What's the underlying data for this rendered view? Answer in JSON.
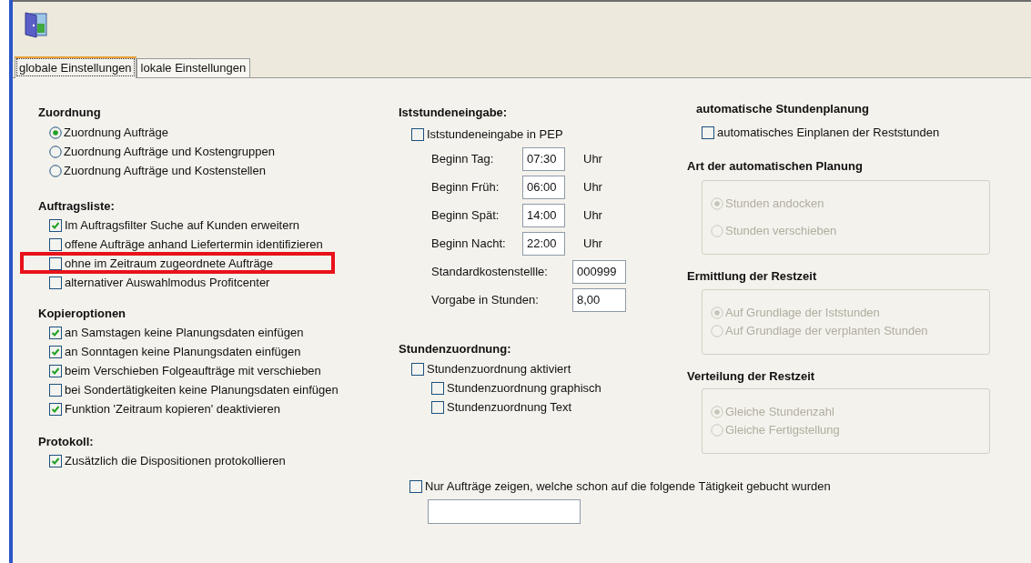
{
  "tabs": [
    {
      "label": "globale Einstellungen",
      "selected": true
    },
    {
      "label": "lokale Einstellungen",
      "selected": false
    }
  ],
  "zuordnung": {
    "title": "Zuordnung",
    "options": [
      {
        "label": "Zuordnung Aufträge",
        "selected": true
      },
      {
        "label": "Zuordnung Aufträge und Kostengruppen",
        "selected": false
      },
      {
        "label": "Zuordnung Aufträge und Kostenstellen",
        "selected": false
      }
    ]
  },
  "auftragsliste": {
    "title": "Auftragsliste:",
    "items": [
      {
        "label": "Im Auftragsfilter Suche auf Kunden erweitern",
        "checked": true,
        "highlighted": false
      },
      {
        "label": "offene Aufträge anhand Liefertermin identifizieren",
        "checked": false,
        "highlighted": false
      },
      {
        "label": "ohne im Zeitraum zugeordnete Aufträge",
        "checked": false,
        "highlighted": true
      },
      {
        "label": "alternativer Auswahlmodus Profitcenter",
        "checked": false,
        "highlighted": false
      }
    ]
  },
  "kopieroptionen": {
    "title": "Kopieroptionen",
    "items": [
      {
        "label": "an Samstagen keine Planungsdaten einfügen",
        "checked": true
      },
      {
        "label": "an Sonntagen keine Planungsdaten einfügen",
        "checked": true
      },
      {
        "label": "beim Verschieben Folgeaufträge mit verschieben",
        "checked": true
      },
      {
        "label": "bei Sondertätigkeiten keine Planungsdaten einfügen",
        "checked": false
      },
      {
        "label": "Funktion 'Zeitraum kopieren' deaktivieren",
        "checked": true
      }
    ]
  },
  "protokoll": {
    "title": "Protokoll:",
    "items": [
      {
        "label": "Zusätzlich die Dispositionen protokollieren",
        "checked": true
      }
    ]
  },
  "iststundeneingabe": {
    "title": "Iststundeneingabe:",
    "checkbox": {
      "label": "Iststundeneingabe in PEP",
      "checked": false
    },
    "fields": [
      {
        "kind": "time",
        "label": "Beginn Tag:",
        "value": "07:30",
        "unit": "Uhr"
      },
      {
        "kind": "time",
        "label": "Beginn Früh:",
        "value": "06:00",
        "unit": "Uhr"
      },
      {
        "kind": "time",
        "label": "Beginn Spät:",
        "value": "14:00",
        "unit": "Uhr"
      },
      {
        "kind": "time",
        "label": "Beginn Nacht:",
        "value": "22:00",
        "unit": "Uhr"
      },
      {
        "kind": "number",
        "label": "Standardkostenstellle:",
        "value": "000999"
      },
      {
        "kind": "number",
        "label": "Vorgabe in Stunden:",
        "value": "8,00"
      }
    ]
  },
  "stundenzuordnung": {
    "title": "Stundenzuordnung:",
    "checkbox": {
      "label": "Stundenzuordnung aktiviert",
      "checked": false,
      "children": [
        {
          "label": "Stundenzuordnung graphisch",
          "checked": false
        },
        {
          "label": "Stundenzuordnung Text",
          "checked": false
        }
      ]
    }
  },
  "automatische_stundenplanung": {
    "title": "automatische Stundenplanung",
    "checkbox": {
      "label": "automatisches Einplanen der Reststunden",
      "checked": false
    }
  },
  "planungsgruppen": [
    {
      "title": "Art der automatischen Planung",
      "disabled": true,
      "options": [
        {
          "label": "Stunden andocken",
          "selected": true
        },
        {
          "label": "Stunden verschieben",
          "selected": false
        }
      ]
    },
    {
      "title": "Ermittlung der Restzeit",
      "disabled": true,
      "options": [
        {
          "label": "Auf Grundlage der Iststunden",
          "selected": true
        },
        {
          "label": "Auf Grundlage der verplanten Stunden",
          "selected": false
        }
      ]
    },
    {
      "title": "Verteilung der Restzeit",
      "disabled": true,
      "options": [
        {
          "label": "Gleiche Stundenzahl",
          "selected": true
        },
        {
          "label": "Gleiche Fertigstellung",
          "selected": false
        }
      ]
    }
  ],
  "nur_auftraege": {
    "label": "Nur Aufträge zeigen, welche schon auf die folgende Tätigkeit gebucht wurden",
    "checked": false
  }
}
